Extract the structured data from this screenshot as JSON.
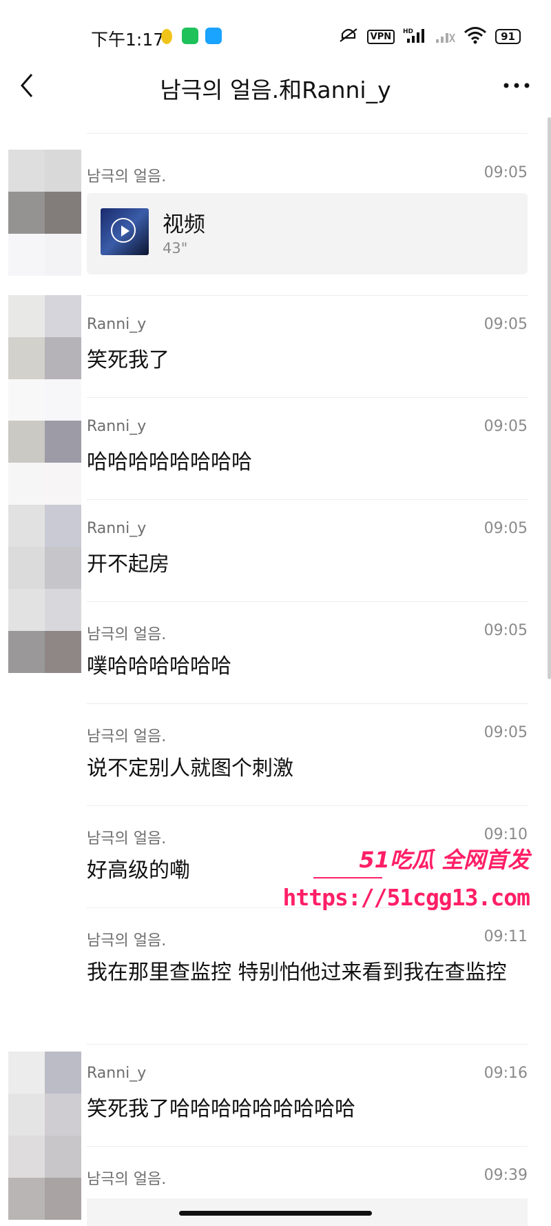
{
  "status_bar": {
    "time": "下午1:17",
    "battery": "91",
    "vpn": "VPN",
    "hd": "HD"
  },
  "header": {
    "title": "남극의 얼음.和Ranni_y"
  },
  "video_message": {
    "sender": "남극의 얼음.",
    "time": "09:05",
    "title": "视频",
    "duration": "43\""
  },
  "messages": [
    {
      "sender": "Ranni_y",
      "time": "09:05",
      "text": "笑死我了"
    },
    {
      "sender": "Ranni_y",
      "time": "09:05",
      "text": "哈哈哈哈哈哈哈哈"
    },
    {
      "sender": "Ranni_y",
      "time": "09:05",
      "text": "开不起房"
    },
    {
      "sender": "남극의 얼음.",
      "time": "09:05",
      "text": "噗哈哈哈哈哈哈"
    },
    {
      "sender": "남극의 얼음.",
      "time": "09:05",
      "text": "说不定别人就图个刺激"
    },
    {
      "sender": "남극의 얼음.",
      "time": "09:10",
      "text": "好高级的嘞"
    },
    {
      "sender": "남극의 얼음.",
      "time": "09:11",
      "text": "我在那里查监控 特别怕他过来看到我在查监控"
    },
    {
      "sender": "Ranni_y",
      "time": "09:16",
      "text": "笑死我了哈哈哈哈哈哈哈哈哈"
    },
    {
      "sender": "남극의 얼음.",
      "time": "09:39",
      "text": ""
    }
  ],
  "watermark": {
    "brand": "51吃瓜 全网首发",
    "url": "https://51cgg13.com"
  },
  "colors": {
    "background": "#ffffff",
    "meta_text": "#8a8a8a",
    "watermark": "#ff1f66"
  }
}
